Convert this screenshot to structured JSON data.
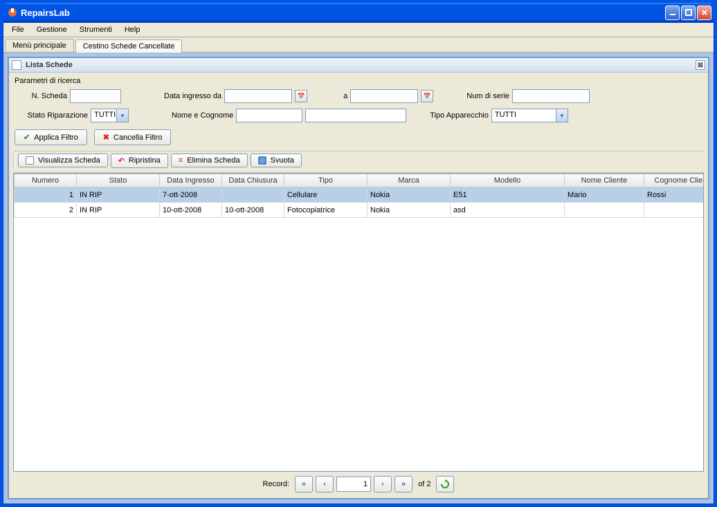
{
  "window": {
    "title": "RepairsLab"
  },
  "menu": {
    "items": [
      "File",
      "Gestione",
      "Strumenti",
      "Help"
    ]
  },
  "tabs": [
    {
      "label": "Menù principale",
      "active": false
    },
    {
      "label": "Cestino Schede Cancellate",
      "active": true
    }
  ],
  "panel": {
    "title": "Lista Schede"
  },
  "search": {
    "title": "Parametri di ricerca",
    "n_scheda_label": "N. Scheda",
    "n_scheda_value": "",
    "data_da_label": "Data ingresso da",
    "data_da_value": "",
    "a_label": "a",
    "a_value": "",
    "num_serie_label": "Num di serie",
    "num_serie_value": "",
    "stato_label": "Stato Riparazione",
    "stato_value": "TUTTI",
    "nome_label": "Nome e Cognome",
    "nome_value": "",
    "cognome_value": "",
    "tipo_app_label": "Tipo Apparecchio",
    "tipo_app_value": "TUTTI",
    "applica_label": "Applica Filtro",
    "cancella_label": "Cancella Filtro"
  },
  "toolbar": {
    "visualizza": "Visualizza Scheda",
    "ripristina": "Ripristina",
    "elimina": "Elimina Scheda",
    "svuota": "Svuota"
  },
  "table": {
    "headers": [
      "Numero",
      "Stato",
      "Data Ingresso",
      "Data Chiusura",
      "Tipo",
      "Marca",
      "Modello",
      "Nome Cliente",
      "Cognome Cliente"
    ],
    "rows": [
      {
        "selected": true,
        "cells": [
          "1",
          "IN RIP",
          "7-ott-2008",
          "",
          "Cellulare",
          "Nokia",
          "E51",
          "Mario",
          "Rossi"
        ]
      },
      {
        "selected": false,
        "cells": [
          "2",
          "IN RIP",
          "10-ott-2008",
          "10-ott-2008",
          "Fotocopiatrice",
          "Nokia",
          "asd",
          "",
          ""
        ]
      }
    ]
  },
  "pager": {
    "label": "Record:",
    "current": "1",
    "of_label": "of",
    "total": "2"
  }
}
